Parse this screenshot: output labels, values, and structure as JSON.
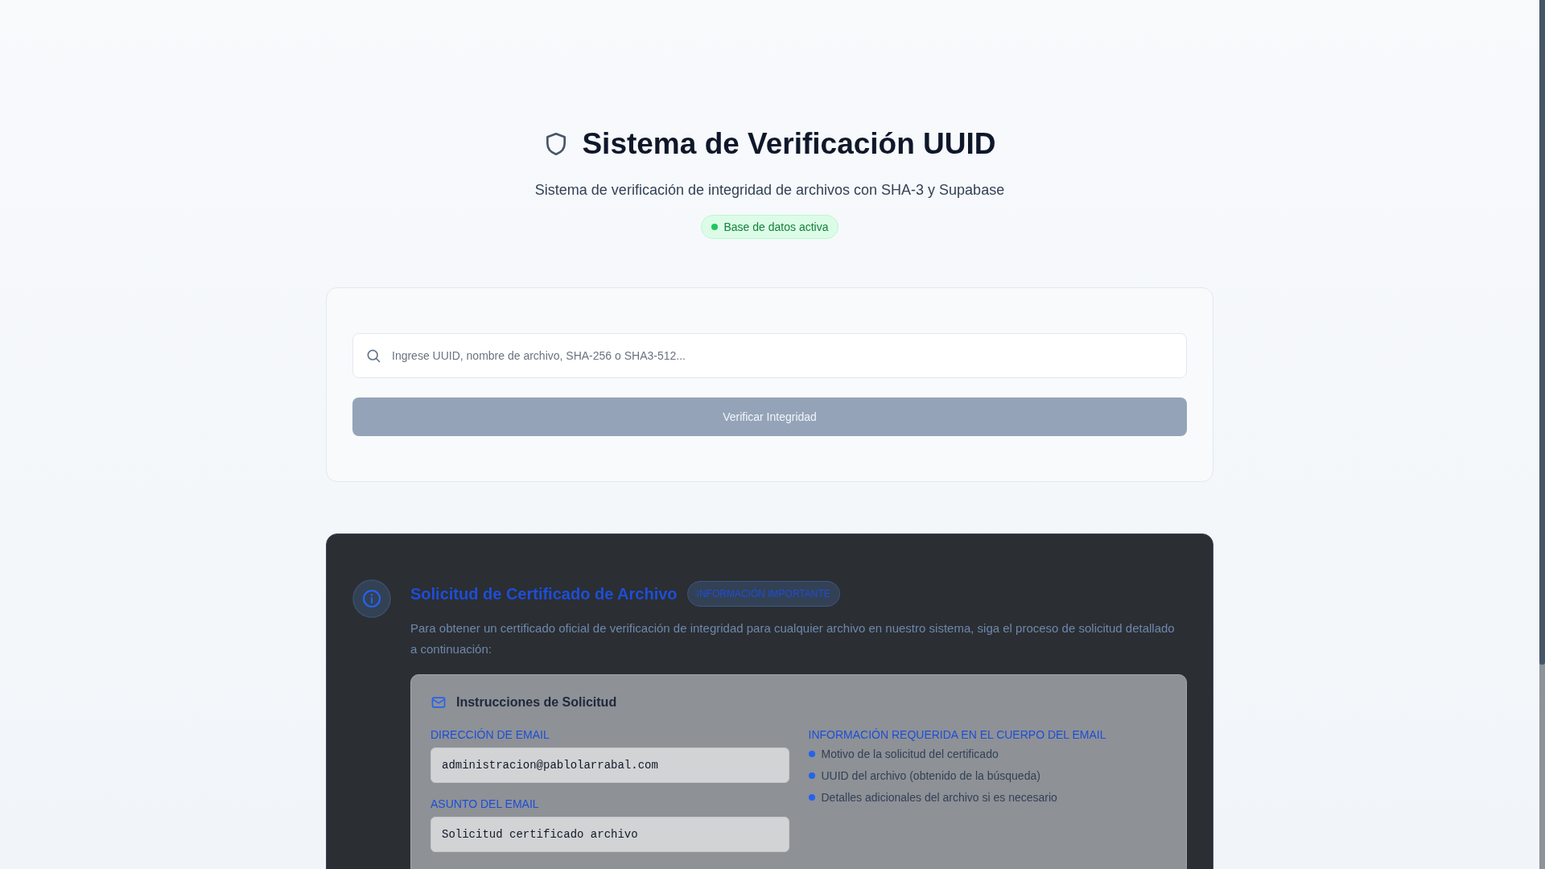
{
  "header": {
    "title": "Sistema de Verificación UUID",
    "subtitle": "Sistema de verificación de integridad de archivos con SHA-3 y Supabase",
    "status": {
      "label": "Base de datos activa",
      "color": "#22c55e"
    }
  },
  "search": {
    "placeholder": "Ingrese UUID, nombre de archivo, SHA-256 o SHA3-512...",
    "button": {
      "label": "Verificar Integridad",
      "disabled": true
    }
  },
  "request": {
    "title": "Solicitud de Certificado de Archivo",
    "badge": "INFORMACIÓN IMPORTANTE",
    "description": "Para obtener un certificado oficial de verificación de integridad para cualquier archivo en nuestro sistema, siga el proceso de solicitud detallado a continuación:",
    "instructions": {
      "title": "Instrucciones de Solicitud",
      "fields": [
        {
          "label": "DIRECCIÓN DE EMAIL",
          "value": "administracion@pablolarrabal.com"
        },
        {
          "label": "ASUNTO DEL EMAIL",
          "value": "Solicitud certificado archivo"
        }
      ],
      "required_title": "INFORMACIÓN REQUERIDA EN EL CUERPO DEL EMAIL",
      "required_items": [
        "Motivo de la solicitud del certificado",
        "UUID del archivo (obtenido de la búsqueda)",
        "Detalles adicionales del archivo si es necesario"
      ]
    }
  }
}
